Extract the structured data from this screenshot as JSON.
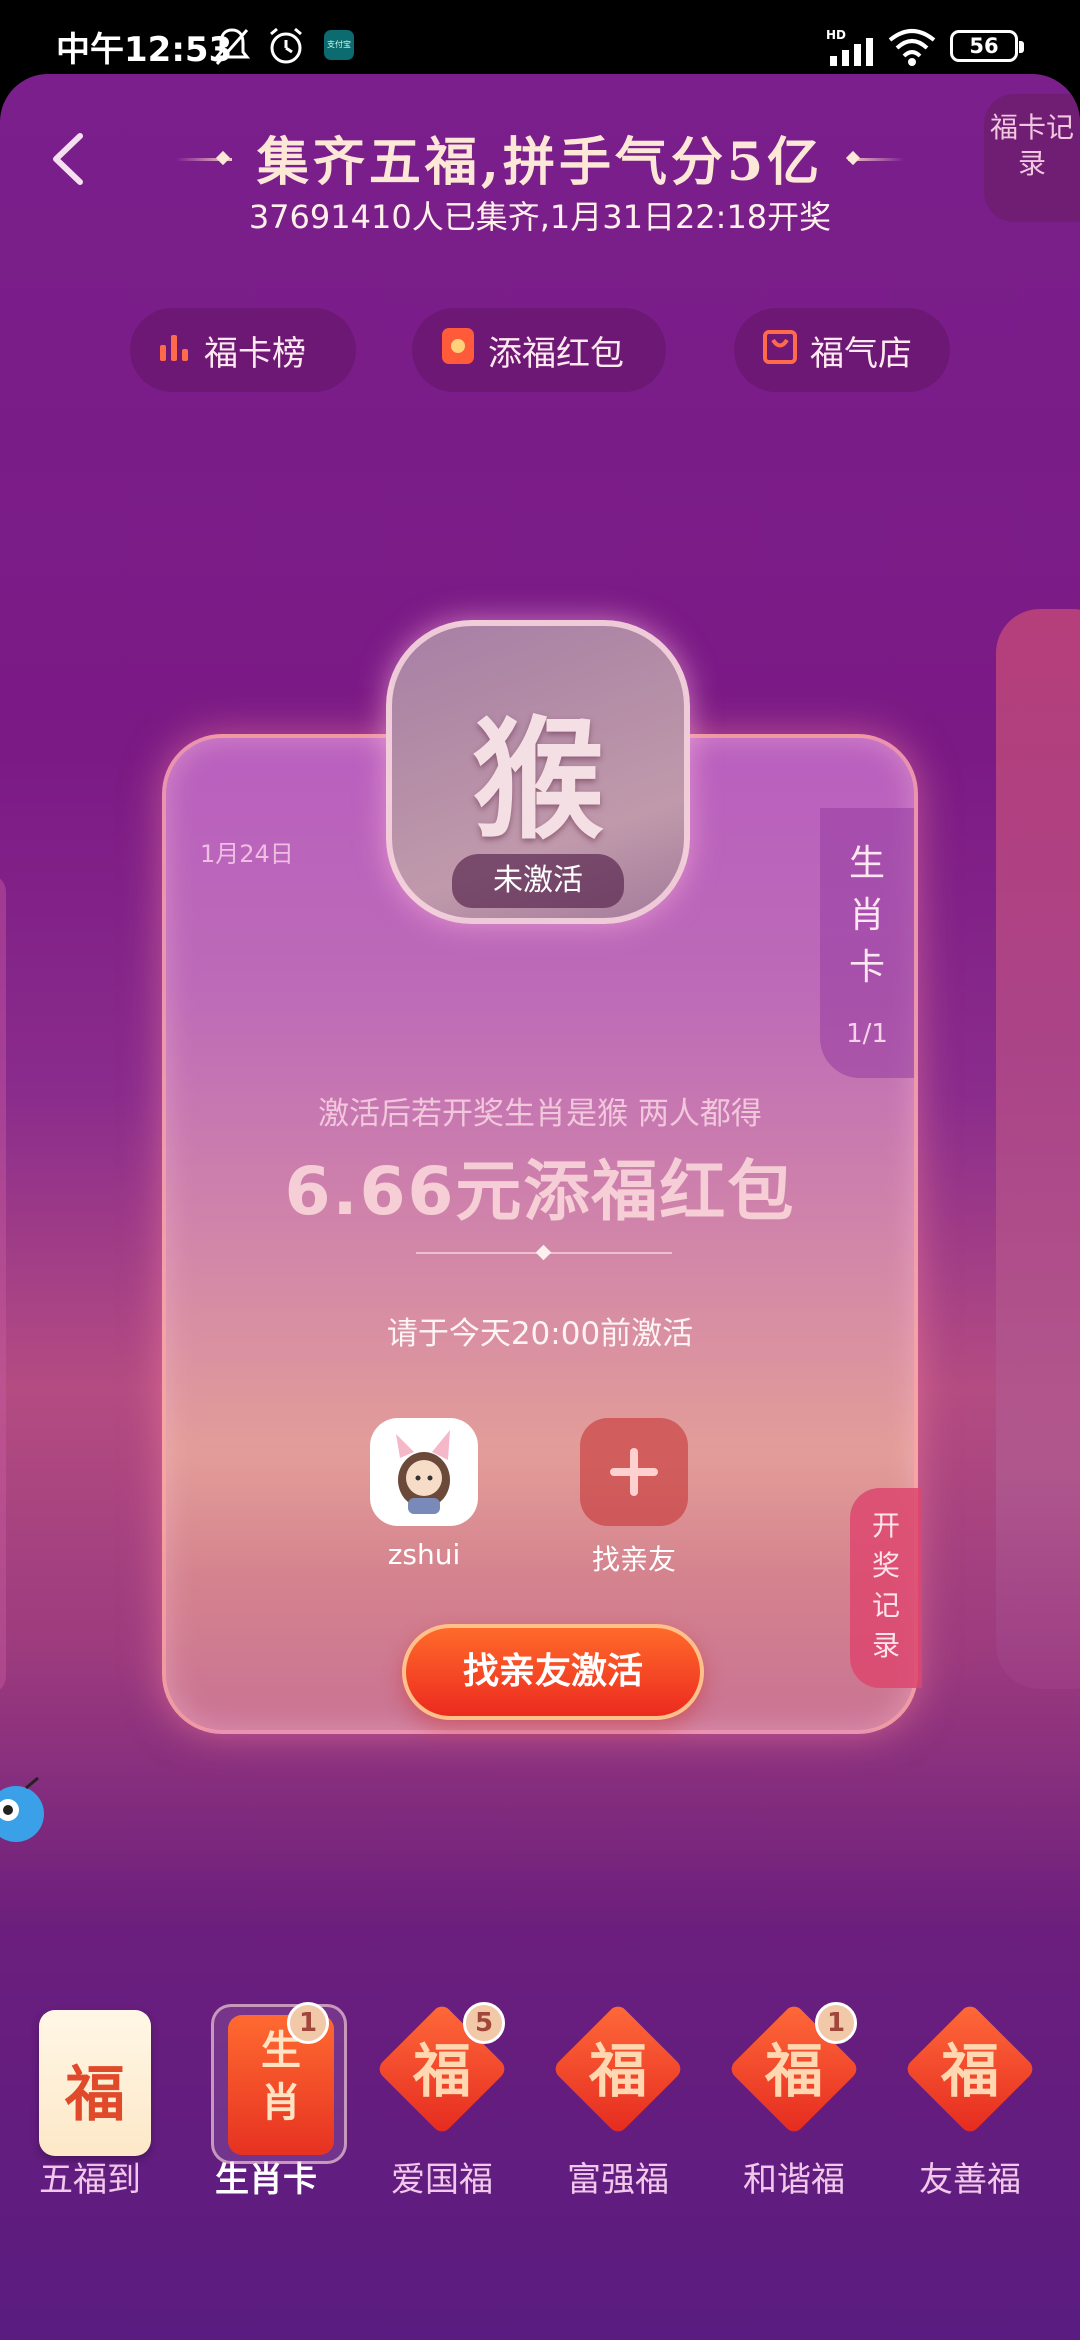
{
  "status_bar": {
    "time": "中午12:53",
    "network": "HD",
    "battery": "56",
    "mini_app_label": "支付宝"
  },
  "header": {
    "title": "集齐五福,拼手气分5亿",
    "subtitle": "37691410人已集齐,1月31日22:18开奖",
    "record_label": "福卡记录"
  },
  "pills": [
    {
      "label": "福卡榜",
      "icon": "bar-chart-icon"
    },
    {
      "label": "添福红包",
      "icon": "red-packet-icon"
    },
    {
      "label": "福气店",
      "icon": "shopping-bag-icon"
    }
  ],
  "card": {
    "date": "1月24日",
    "zodiac_char": "猴",
    "status": "未激活",
    "zodiac_tab_chars": [
      "生",
      "肖",
      "卡"
    ],
    "zodiac_count": "1/1",
    "hint": "激活后若开奖生肖是猴 两人都得",
    "amount": "6.66元添福红包",
    "deadline": "请于今天20:00前激活",
    "friends": [
      {
        "name": "zshui"
      },
      {
        "name": "找亲友"
      }
    ],
    "activate_button": "找亲友激活",
    "draw_record_label": "开奖记录"
  },
  "tabs": [
    {
      "label": "五福到",
      "char": "福",
      "badge": ""
    },
    {
      "label": "生肖卡",
      "char": "生肖",
      "badge": "1"
    },
    {
      "label": "爱国福",
      "char": "福",
      "badge": "5"
    },
    {
      "label": "富强福",
      "char": "福",
      "badge": ""
    },
    {
      "label": "和谐福",
      "char": "福",
      "badge": "1"
    },
    {
      "label": "友善福",
      "char": "福",
      "badge": ""
    }
  ],
  "colors": {
    "background": "#7a1f8c",
    "accent": "#ec2a20",
    "card": "#c97394"
  }
}
